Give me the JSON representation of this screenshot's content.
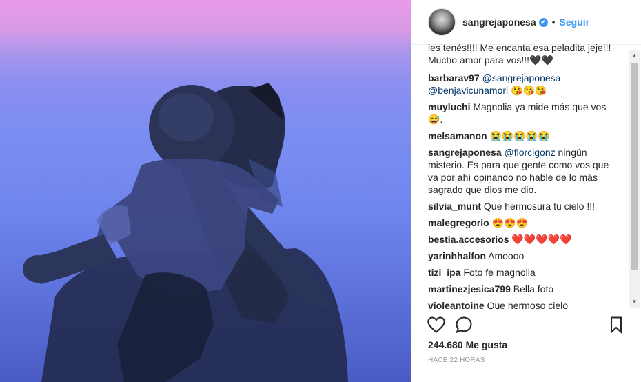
{
  "post": {
    "username": "sangrejaponesa",
    "verified_badge": "✔",
    "separator": "•",
    "follow_label": "Seguir"
  },
  "comments": [
    {
      "user": "",
      "text": "les tenés!!!! Me encanta esa peladita jeje!!!"
    },
    {
      "user": "",
      "text": "Mucho amor para vos!!!🖤🖤"
    },
    {
      "user": "barbarav97",
      "mention": "@sangrejaponesa",
      "text2": "@benjavicunamori",
      "emoji": "😘😘😘"
    },
    {
      "user": "muyluchi",
      "text": "Magnolia ya mide más que vos",
      "emoji": "😅."
    },
    {
      "user": "melsamanon",
      "emoji": "😭😭😭😭😭"
    },
    {
      "user": "sangrejaponesa",
      "mention": "@florcigonz",
      "text": "ningún",
      "line2": "misterio. Es para que gente como vos que",
      "line3": "va por ahí opinando no hable de lo más",
      "line4": "sagrado que dios me dio."
    },
    {
      "user": "silvia_munt",
      "text": "Que hermosura tu cielo !!!"
    },
    {
      "user": "malegregorio",
      "emoji": "😍😍😍"
    },
    {
      "user": "bestia.accesorios",
      "emoji": "❤️❤️❤️❤️❤️"
    },
    {
      "user": "yarinhhalfon",
      "text": "Amoooo"
    },
    {
      "user": "tizi_ipa",
      "text": "Foto fe magnolia"
    },
    {
      "user": "martinezjesica799",
      "text": "Bella foto"
    },
    {
      "user": "violeantoine",
      "text": "Que hermoso cielo"
    }
  ],
  "scrollbar": {
    "up": "▲",
    "down": "▼"
  },
  "actions": {
    "like_icon": "heart-icon",
    "comment_icon": "comment-icon",
    "save_icon": "bookmark-icon"
  },
  "likes_text": "244.680 Me gusta",
  "timestamp": "HACE 22 HORAS",
  "colors": {
    "accent": "#3897f0",
    "text": "#262626",
    "muted": "#999999"
  }
}
